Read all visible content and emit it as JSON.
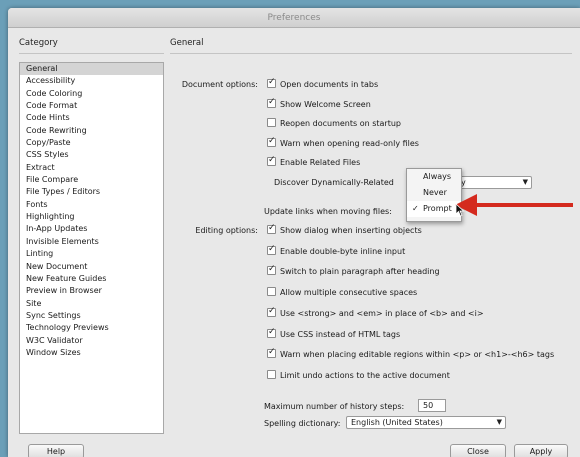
{
  "window": {
    "title": "Preferences"
  },
  "header": {
    "category": "Category",
    "section": "General"
  },
  "categories": [
    "General",
    "Accessibility",
    "Code Coloring",
    "Code Format",
    "Code Hints",
    "Code Rewriting",
    "Copy/Paste",
    "CSS Styles",
    "Extract",
    "File Compare",
    "File Types / Editors",
    "Fonts",
    "Highlighting",
    "In-App Updates",
    "Invisible Elements",
    "Linting",
    "New Document",
    "New Feature Guides",
    "Preview in Browser",
    "Site",
    "Sync Settings",
    "Technology Previews",
    "W3C Validator",
    "Window Sizes"
  ],
  "document_options": {
    "label": "Document options:",
    "items": [
      {
        "label": "Open documents in tabs",
        "checked": true
      },
      {
        "label": "Show Welcome Screen",
        "checked": true
      },
      {
        "label": "Reopen documents on startup",
        "checked": false
      },
      {
        "label": "Warn when opening read-only files",
        "checked": true
      },
      {
        "label": "Enable Related Files",
        "checked": true
      }
    ],
    "discover_label": "Discover Dynamically-Related",
    "discover_value": "y",
    "update_links_label": "Update links when moving files:"
  },
  "update_links_popup": {
    "options": [
      "Always",
      "Never",
      "Prompt"
    ],
    "selected": "Prompt",
    "check": "✓"
  },
  "editing_options": {
    "label": "Editing options:",
    "items": [
      {
        "label": "Show dialog when inserting objects",
        "checked": true
      },
      {
        "label": "Enable double-byte inline input",
        "checked": true
      },
      {
        "label": "Switch to plain paragraph after heading",
        "checked": true
      },
      {
        "label": "Allow multiple consecutive spaces",
        "checked": false
      },
      {
        "label": "Use <strong> and <em> in place of <b> and <i>",
        "checked": true
      },
      {
        "label": "Use CSS instead of HTML tags",
        "checked": true
      },
      {
        "label": "Warn when placing editable regions within <p> or <h1>-<h6> tags",
        "checked": true
      },
      {
        "label": "Limit undo actions to the active document",
        "checked": false
      }
    ]
  },
  "history": {
    "label": "Maximum number of history steps:",
    "value": "50"
  },
  "spelling": {
    "label": "Spelling dictionary:",
    "value": "English (United States)"
  },
  "buttons": {
    "help": "Help",
    "close": "Close",
    "apply": "Apply"
  },
  "colors": {
    "annotation_arrow": "#d42a1e",
    "background": "#6b9fb8"
  }
}
